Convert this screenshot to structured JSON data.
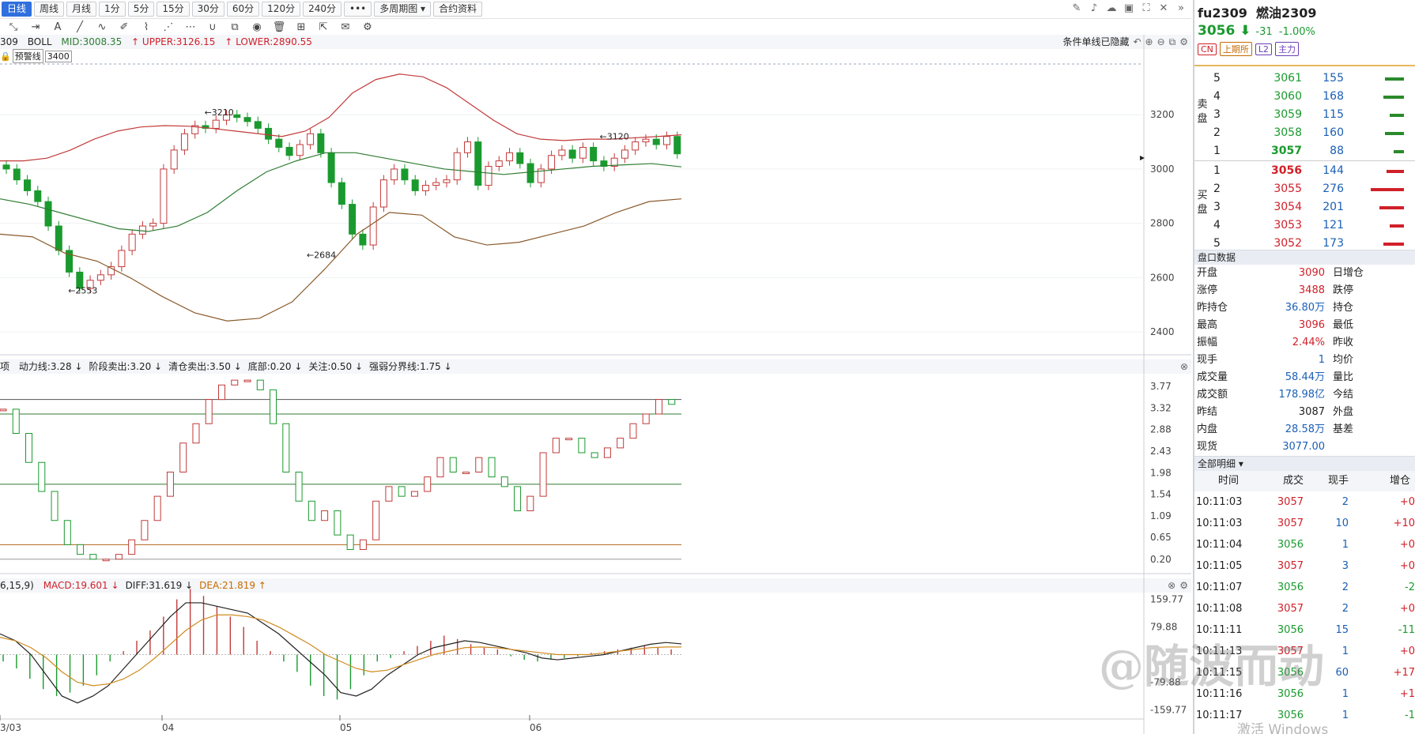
{
  "toolbar": {
    "periods": [
      "日线",
      "周线",
      "月线",
      "1分",
      "5分",
      "15分",
      "30分",
      "60分",
      "120分",
      "240分",
      "•••",
      "多周期图",
      "合约资料"
    ],
    "active_period": "日线"
  },
  "boll_header": {
    "prefix": "309",
    "name": "BOLL",
    "mid": "MID:3008.35",
    "upper": "UPPER:3126.15",
    "lower": "LOWER:2890.55",
    "notice": "条件单线已隐藏"
  },
  "alert": {
    "label": "预警线",
    "value": "3400"
  },
  "kd_header": {
    "prefix": "项",
    "items": [
      {
        "text": "动力线:3.28",
        "dir": "down"
      },
      {
        "text": "阶段卖出:3.20",
        "dir": "down"
      },
      {
        "text": "清仓卖出:3.50",
        "dir": "down"
      },
      {
        "text": "底部:0.20",
        "dir": "down"
      },
      {
        "text": "关注:0.50",
        "dir": "down"
      },
      {
        "text": "强弱分界线:1.75",
        "dir": "down"
      }
    ]
  },
  "macd_header": {
    "params": "6,15,9)",
    "items": [
      {
        "text": "MACD:19.601",
        "dir": "down"
      },
      {
        "text": "DIFF:31.619",
        "dir": "down"
      },
      {
        "text": "DEA:21.819",
        "dir": "up"
      }
    ]
  },
  "chart_data": [
    {
      "type": "candlestick",
      "title": "",
      "y_ticks": [
        "3200",
        "3000",
        "2800",
        "2600",
        "2400"
      ],
      "ylim": [
        2330,
        3390
      ],
      "annotations": [
        {
          "label": "3210",
          "value": 3210
        },
        {
          "label": "3120",
          "value": 3120
        },
        {
          "label": "2684",
          "value": 2684
        },
        {
          "label": "2553",
          "value": 2553
        }
      ],
      "x_ticks": [
        "3/03",
        "04",
        "05",
        "06"
      ],
      "closes": [
        3000,
        2960,
        2920,
        2880,
        2790,
        2700,
        2620,
        2560,
        2590,
        2610,
        2640,
        2700,
        2760,
        2790,
        2800,
        3000,
        3070,
        3130,
        3160,
        3150,
        3180,
        3200,
        3190,
        3175,
        3150,
        3110,
        3080,
        3050,
        3090,
        3130,
        3060,
        2950,
        2870,
        2760,
        2720,
        2860,
        2960,
        3000,
        2960,
        2920,
        2940,
        2950,
        2960,
        3060,
        3100,
        2940,
        3010,
        3030,
        3060,
        3020,
        2950,
        3000,
        3050,
        3070,
        3040,
        3080,
        3030,
        3010,
        3040,
        3070,
        3100,
        3110,
        3090,
        3120,
        3056
      ],
      "bands": {
        "upper": [
          3030,
          3030,
          3040,
          3070,
          3110,
          3140,
          3155,
          3160,
          3158,
          3150,
          3140,
          3130,
          3120,
          3140,
          3190,
          3280,
          3330,
          3350,
          3340,
          3300,
          3240,
          3180,
          3130,
          3110,
          3105,
          3110,
          3110,
          3115,
          3120,
          3126
        ],
        "mid": [
          2890,
          2870,
          2840,
          2810,
          2780,
          2770,
          2790,
          2840,
          2920,
          2990,
          3030,
          3060,
          3060,
          3040,
          3020,
          3000,
          2990,
          2980,
          2990,
          3000,
          3010,
          3015,
          3020,
          3008
        ],
        "lower": [
          2760,
          2750,
          2690,
          2660,
          2600,
          2530,
          2470,
          2440,
          2450,
          2510,
          2630,
          2760,
          2840,
          2830,
          2750,
          2720,
          2730,
          2760,
          2790,
          2840,
          2880,
          2890
        ]
      }
    },
    {
      "type": "candlestick-indicator",
      "title": "",
      "y_ticks": [
        "3.77",
        "3.32",
        "2.88",
        "2.43",
        "1.98",
        "1.54",
        "1.09",
        "0.65",
        "0.20"
      ],
      "ylim": [
        0.0,
        4.0
      ],
      "reference_lines": [
        3.5,
        3.2,
        1.75,
        0.5,
        0.2
      ],
      "values": [
        3.3,
        2.8,
        2.2,
        1.6,
        1.0,
        0.5,
        0.3,
        0.2,
        0.2,
        0.3,
        0.6,
        1.0,
        1.5,
        2.0,
        2.6,
        3.0,
        3.5,
        3.8,
        3.9,
        3.9,
        3.7,
        3.0,
        2.0,
        1.4,
        1.0,
        1.2,
        0.7,
        0.4,
        0.6,
        1.4,
        1.7,
        1.5,
        1.6,
        1.9,
        2.3,
        2.0,
        2.0,
        2.3,
        1.9,
        1.7,
        1.2,
        1.5,
        2.4,
        2.7,
        2.7,
        2.4,
        2.3,
        2.5,
        2.7,
        3.0,
        3.2,
        3.5,
        3.4
      ]
    },
    {
      "type": "bar+line",
      "title": "",
      "y_ticks": [
        "159.77",
        "79.88",
        "-79.88",
        "-159.77"
      ],
      "ylim": [
        -175,
        175
      ],
      "histogram": [
        -20,
        -40,
        -70,
        -100,
        -120,
        -110,
        -90,
        -60,
        -20,
        10,
        40,
        70,
        110,
        160,
        190,
        170,
        140,
        110,
        80,
        40,
        10,
        -20,
        -50,
        -90,
        -120,
        -130,
        -100,
        -60,
        -20,
        -10,
        10,
        25,
        40,
        55,
        45,
        30,
        20,
        15,
        -5,
        -15,
        -20,
        -15,
        -10,
        -5,
        5,
        10,
        15,
        20,
        25,
        20,
        15
      ],
      "diff": [
        60,
        40,
        0,
        -60,
        -120,
        -140,
        -120,
        -90,
        -40,
        10,
        60,
        110,
        150,
        150,
        140,
        130,
        120,
        90,
        60,
        20,
        -20,
        -60,
        -110,
        -120,
        -100,
        -60,
        -30,
        0,
        20,
        30,
        40,
        35,
        25,
        15,
        5,
        -10,
        -15,
        -10,
        -5,
        0,
        10,
        20,
        30,
        35,
        31
      ],
      "dea": [
        50,
        40,
        20,
        -10,
        -50,
        -80,
        -90,
        -85,
        -70,
        -45,
        -10,
        30,
        70,
        100,
        115,
        115,
        110,
        100,
        80,
        55,
        30,
        0,
        -20,
        -40,
        -50,
        -45,
        -30,
        -15,
        0,
        10,
        20,
        22,
        20,
        15,
        10,
        5,
        0,
        0,
        0,
        5,
        10,
        15,
        20,
        22,
        22
      ]
    }
  ],
  "panel": {
    "code": "fu2309",
    "name": "燃油2309",
    "price": "3056",
    "change": "-31",
    "pct": "-1.00%",
    "tags": [
      "CN",
      "上期所",
      "L2",
      "主力"
    ],
    "sell_label": "卖盘",
    "buy_label": "买盘",
    "asks": [
      {
        "lvl": "5",
        "price": "3061",
        "vol": "155",
        "bar": 0.56
      },
      {
        "lvl": "4",
        "price": "3060",
        "vol": "168",
        "bar": 0.61
      },
      {
        "lvl": "3",
        "price": "3059",
        "vol": "115",
        "bar": 0.42
      },
      {
        "lvl": "2",
        "price": "3058",
        "vol": "160",
        "bar": 0.58
      },
      {
        "lvl": "1",
        "price": "3057",
        "vol": "88",
        "bar": 0.32
      }
    ],
    "bids": [
      {
        "lvl": "1",
        "price": "3056",
        "vol": "144",
        "bar": 0.52
      },
      {
        "lvl": "2",
        "price": "3055",
        "vol": "276",
        "bar": 1.0
      },
      {
        "lvl": "3",
        "price": "3054",
        "vol": "201",
        "bar": 0.73
      },
      {
        "lvl": "4",
        "price": "3053",
        "vol": "121",
        "bar": 0.44
      },
      {
        "lvl": "5",
        "price": "3052",
        "vol": "173",
        "bar": 0.63
      }
    ],
    "stats_title": "盘口数据",
    "stats": [
      {
        "k": "开盘",
        "v": "3090",
        "k2": "日增仓",
        "color": "up"
      },
      {
        "k": "涨停",
        "v": "3488",
        "k2": "跌停",
        "color": "up"
      },
      {
        "k": "昨持仓",
        "v": "36.80万",
        "k2": "持仓",
        "color": "blue"
      },
      {
        "k": "最高",
        "v": "3096",
        "k2": "最低",
        "color": "up"
      },
      {
        "k": "振幅",
        "v": "2.44%",
        "k2": "昨收",
        "color": "up"
      },
      {
        "k": "现手",
        "v": "1",
        "k2": "均价",
        "color": "blue"
      },
      {
        "k": "成交量",
        "v": "58.44万",
        "k2": "量比",
        "color": "blue"
      },
      {
        "k": "成交额",
        "v": "178.98亿",
        "k2": "今结",
        "color": "blue"
      },
      {
        "k": "昨结",
        "v": "3087",
        "k2": "外盘",
        "color": "plain"
      },
      {
        "k": "内盘",
        "v": "28.58万",
        "k2": "基差",
        "color": "blue"
      },
      {
        "k": "现货",
        "v": "3077.00",
        "k2": "",
        "color": "blue"
      }
    ],
    "ticks_title": "全部明细",
    "ticks_head": [
      "时间",
      "成交",
      "现手",
      "增仓"
    ],
    "ticks": [
      {
        "t": "10:11:03",
        "p": "3057",
        "q": "2",
        "d": "+0"
      },
      {
        "t": "10:11:03",
        "p": "3057",
        "q": "10",
        "d": "+10"
      },
      {
        "t": "10:11:04",
        "p": "3056",
        "q": "1",
        "d": "+0"
      },
      {
        "t": "10:11:05",
        "p": "3057",
        "q": "3",
        "d": "+0"
      },
      {
        "t": "10:11:07",
        "p": "3056",
        "q": "2",
        "d": "-2"
      },
      {
        "t": "10:11:08",
        "p": "3057",
        "q": "2",
        "d": "+0"
      },
      {
        "t": "10:11:11",
        "p": "3056",
        "q": "15",
        "d": "-11"
      },
      {
        "t": "10:11:13",
        "p": "3057",
        "q": "1",
        "d": "+0"
      },
      {
        "t": "10:11:15",
        "p": "3056",
        "q": "60",
        "d": "+17"
      },
      {
        "t": "10:11:16",
        "p": "3056",
        "q": "1",
        "d": "+1"
      },
      {
        "t": "10:11:17",
        "p": "3056",
        "q": "1",
        "d": "-1"
      }
    ]
  },
  "watermark": "@随波而动",
  "activate": "激活 Windows",
  "colors": {
    "up": "#d0202a",
    "down": "#1a9a2e",
    "blue": "#1b5fb5",
    "mid": "#2f7d32",
    "upper_band": "#c23a3a",
    "lower_band": "#8a5a2b"
  }
}
